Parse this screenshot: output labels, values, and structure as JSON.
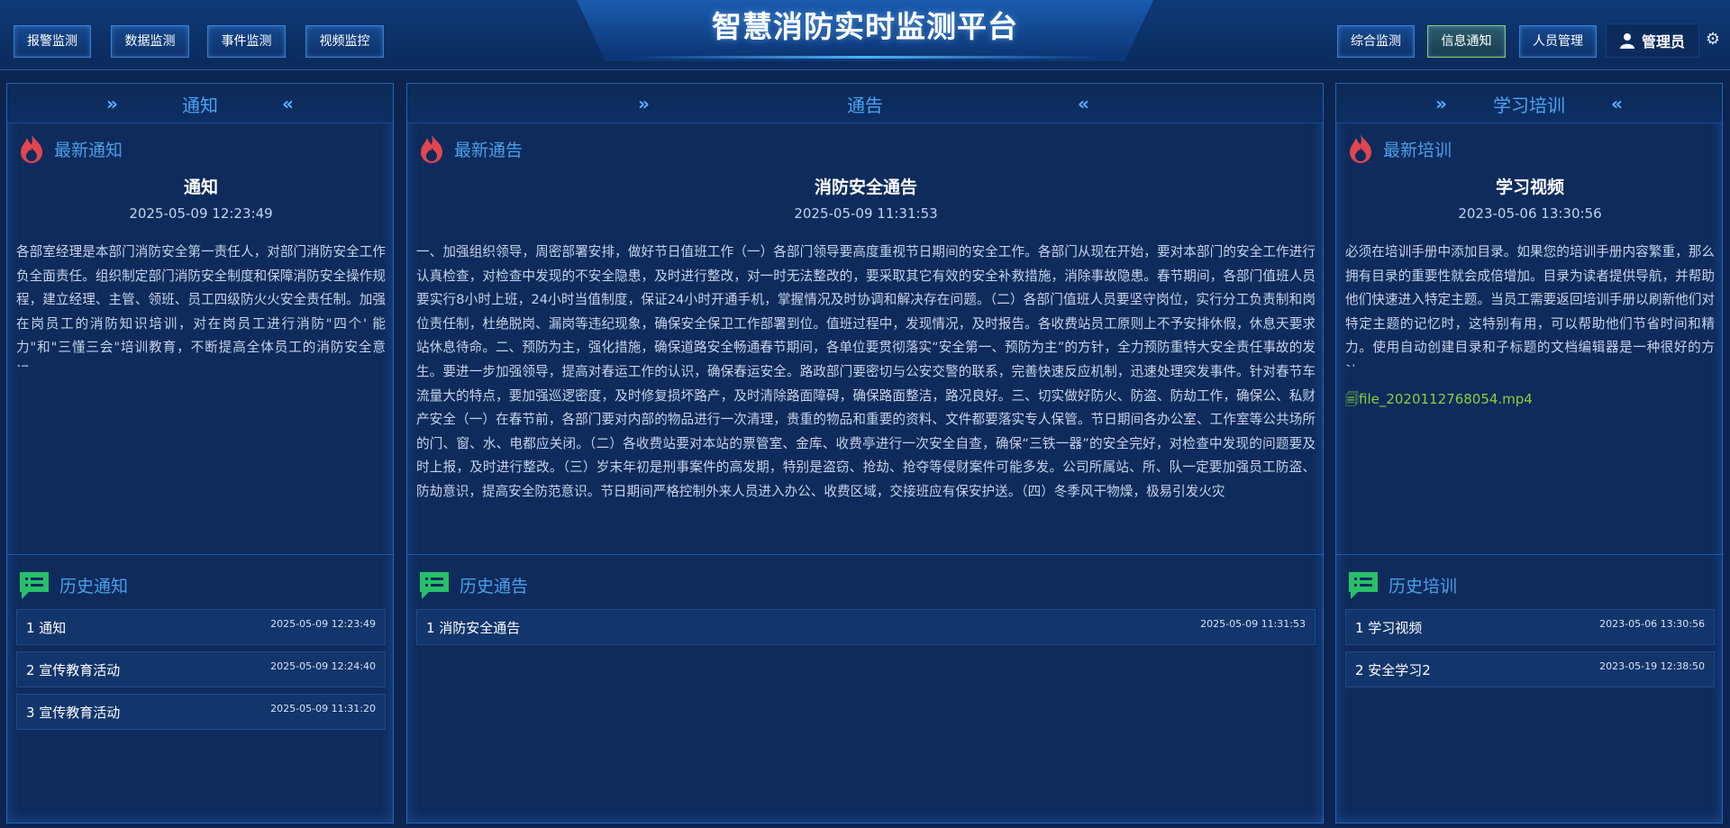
{
  "header": {
    "title": "智慧消防实时监测平台",
    "left_nav": [
      "报警监测",
      "数据监测",
      "事件监测",
      "视频监控"
    ],
    "right_nav": [
      "综合监测",
      "信息通知",
      "人员管理"
    ],
    "active_nav": "信息通知",
    "user": "管理员"
  },
  "panels": {
    "notice": {
      "header": "通知",
      "latest_label": "最新通知",
      "item_title": "通知",
      "item_time": "2025-05-09 12:23:49",
      "item_body": "各部室经理是本部门消防安全第一责任人，对部门消防安全工作负全面责任。组织制定部门消防安全制度和保障消防安全操作规程，建立经理、主管、领班、员工四级防火火安全责任制。加强在岗员工的消防知识培训，对在岗员工进行消防\"四个' 能力\"和\"三懂三会\"培训教育，不断提高全体员工的消防安全意识。",
      "history_label": "历史通知",
      "history": [
        {
          "name": "1 通知",
          "time": "2025-05-09 12:23:49"
        },
        {
          "name": "2 宣传教育活动",
          "time": "2025-05-09 12:24:40"
        },
        {
          "name": "3 宣传教育活动",
          "time": "2025-05-09 11:31:20"
        }
      ]
    },
    "bulletin": {
      "header": "通告",
      "latest_label": "最新通告",
      "item_title": "消防安全通告",
      "item_time": "2025-05-09 11:31:53",
      "item_body": "一、加强组织领导，周密部署安排，做好节日值班工作（一）各部门领导要高度重视节日期间的安全工作。各部门从现在开始，要对本部门的安全工作进行认真检查，对检查中发现的不安全隐患，及时进行整改，对一时无法整改的，要采取其它有效的安全补救措施，消除事故隐患。春节期间，各部门值班人员要实行8小时上班，24小时当值制度，保证24小时开通手机，掌握情况及时协调和解决存在问题。（二）各部门值班人员要坚守岗位，实行分工负责制和岗位责任制，杜绝脱岗、漏岗等违纪现象，确保安全保卫工作部署到位。值班过程中，发现情况，及时报告。各收费站员工原则上不予安排休假，休息天要求站休息待命。二、预防为主，强化措施，确保道路安全畅通春节期间，各单位要贯彻落实“安全第一、预防为主”的方针，全力预防重特大安全责任事故的发生。要进一步加强领导，提高对春运工作的认识，确保春运安全。路政部门要密切与公安交警的联系，完善快速反应机制，迅速处理突发事件。针对春节车流量大的特点，要加强巡逻密度，及时修复损坏路产，及时清除路面障碍，确保路面整洁，路况良好。三、切实做好防火、防盗、防劫工作，确保公、私财产安全（一）在春节前，各部门要对内部的物品进行一次清理，贵重的物品和重要的资料、文件都要落实专人保管。节日期间各办公室、工作室等公共场所的门、窗、水、电都应关闭。（二）各收费站要对本站的票管室、金库、收费亭进行一次安全自查，确保“三铁一器”的安全完好，对检查中发现的问题要及时上报，及时进行整改。（三）岁末年初是刑事案件的高发期，特别是盗窃、抢劫、抢夺等侵财案件可能多发。公司所属站、所、队一定要加强员工防盗、防劫意识，提高安全防范意识。节日期间严格控制外来人员进入办公、收费区域，交接班应有保安护送。（四）冬季风干物燥，极易引发火灾",
      "history_label": "历史通告",
      "history": [
        {
          "name": "1 消防安全通告",
          "time": "2025-05-09 11:31:53"
        }
      ]
    },
    "training": {
      "header": "学习培训",
      "latest_label": "最新培训",
      "item_title": "学习视频",
      "item_time": "2023-05-06 13:30:56",
      "item_body": "必须在培训手册中添加目录。如果您的培训手册内容繁重，那么拥有目录的重要性就会成倍增加。目录为读者提供导航，并帮助他们快速进入特定主题。当员工需要返回培训手册以刷新他们对特定主题的记忆时，这特别有用，可以帮助他们节省时间和精力。使用自动创建目录和子标题的文档编辑器是一种很好的方法。",
      "file": "file_2020112768054.mp4",
      "history_label": "历史培训",
      "history": [
        {
          "name": "1 学习视频",
          "time": "2023-05-06 13:30:56"
        },
        {
          "name": "2 安全学习2",
          "time": "2023-05-19 12:38:50"
        }
      ]
    }
  },
  "colors": {
    "accent": "#4ba3f5",
    "fire_icon": "#e0464e",
    "history_icon": "#27c06a",
    "file_link": "#8ccf3c"
  },
  "icons": {
    "latest": "fire-icon",
    "history": "message-list-icon",
    "user": "user-icon",
    "settings": "gear-icon",
    "file": "file-icon"
  }
}
